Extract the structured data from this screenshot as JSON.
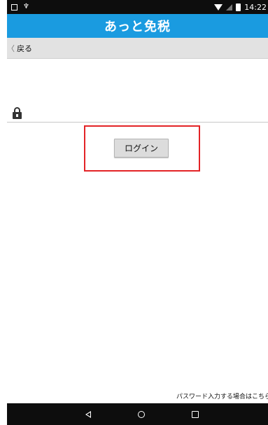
{
  "status_bar": {
    "time": "14:22",
    "icons": [
      "screenshot-icon",
      "usb-plug-icon",
      "wifi-icon",
      "signal-icon",
      "battery-icon"
    ]
  },
  "app_bar": {
    "title": "あっと免税",
    "color": "#1a9be0"
  },
  "back_bar": {
    "back_label": "戻る",
    "chevron": "〈"
  },
  "login": {
    "password_placeholder": "",
    "password_value": "",
    "button_label": "ログイン",
    "highlight_color": "#e32326"
  },
  "footer": {
    "link_text": "パスワード入力する場合はこちら"
  },
  "nav_bar": {
    "buttons": [
      "back-triangle-icon",
      "home-circle-icon",
      "recents-square-icon"
    ]
  }
}
